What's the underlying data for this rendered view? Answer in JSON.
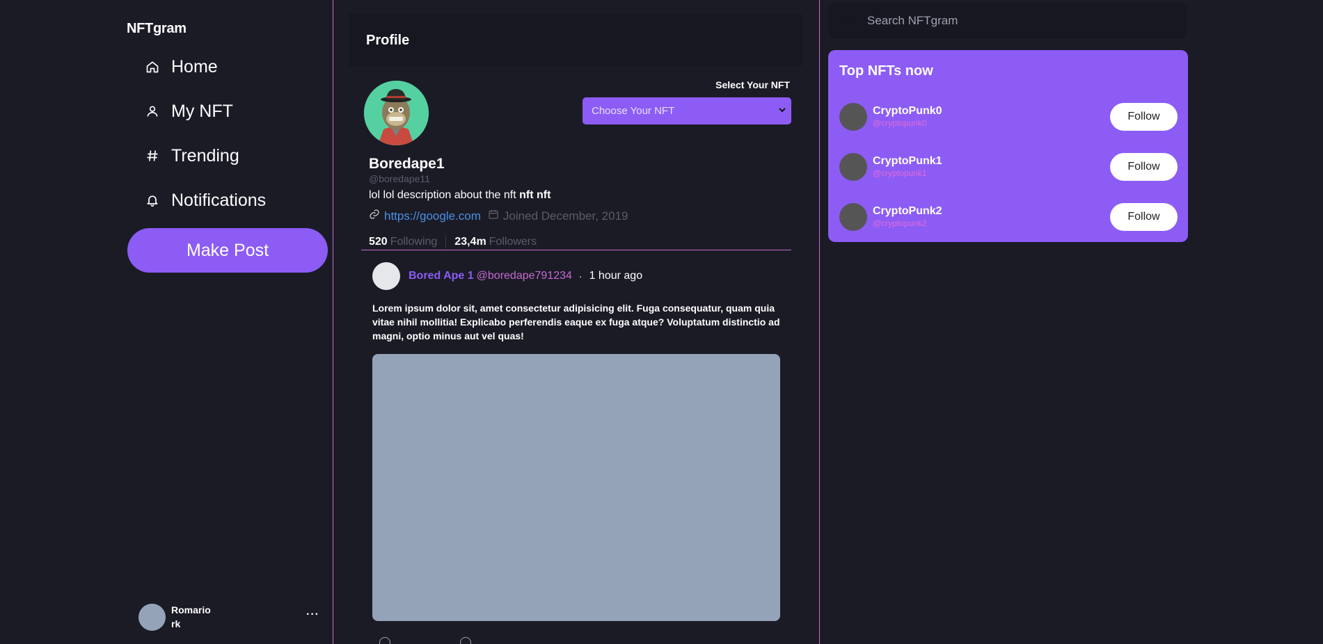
{
  "app": {
    "brand": "NFTgram"
  },
  "sidebar": {
    "items": [
      {
        "label": "Home",
        "icon": "home-icon"
      },
      {
        "label": "My NFT",
        "icon": "user-icon"
      },
      {
        "label": "Trending",
        "icon": "hash-icon"
      },
      {
        "label": "Notifications",
        "icon": "bell-icon"
      }
    ],
    "make_post_label": "Make Post",
    "account": {
      "name_line1": "Romario",
      "name_line2": "rk",
      "more_label": "···"
    }
  },
  "profile": {
    "header_title": "Profile",
    "select_label": "Select Your NFT",
    "select_value": "Choose Your NFT",
    "display_name": "Boredape1",
    "handle": "@boredape11",
    "bio_text": "lol lol description about the nft",
    "bio_bold": "nft nft",
    "link": "https://google.com",
    "joined": "Joined December, 2019",
    "following_count": "520",
    "following_label": "Following",
    "followers_count": "23,4m",
    "followers_label": "Followers"
  },
  "post": {
    "author_name": "Bored Ape 1",
    "author_handle": "@boredape791234",
    "separator": "·",
    "time": "1 hour ago",
    "body": "Lorem ipsum dolor sit, amet consectetur adipisicing elit. Fuga consequatur, quam quia vitae nihil mollitia! Explicabo perferendis eaque ex fuga atque? Voluptatum distinctio ad magni, optio minus aut vel quas!"
  },
  "search": {
    "placeholder": "Search NFTgram"
  },
  "top_nfts": {
    "title": "Top NFTs now",
    "items": [
      {
        "name": "CryptoPunk0",
        "handle": "@cryptopunk0",
        "button": "Follow"
      },
      {
        "name": "CryptoPunk1",
        "handle": "@cryptopunk1",
        "button": "Follow"
      },
      {
        "name": "CryptoPunk2",
        "handle": "@cryptopunk2",
        "button": "Follow"
      }
    ]
  },
  "colors": {
    "background": "#1b1b26",
    "accent": "#8c5cf5",
    "divider": "#c56ad1",
    "link": "#4a90e2"
  }
}
